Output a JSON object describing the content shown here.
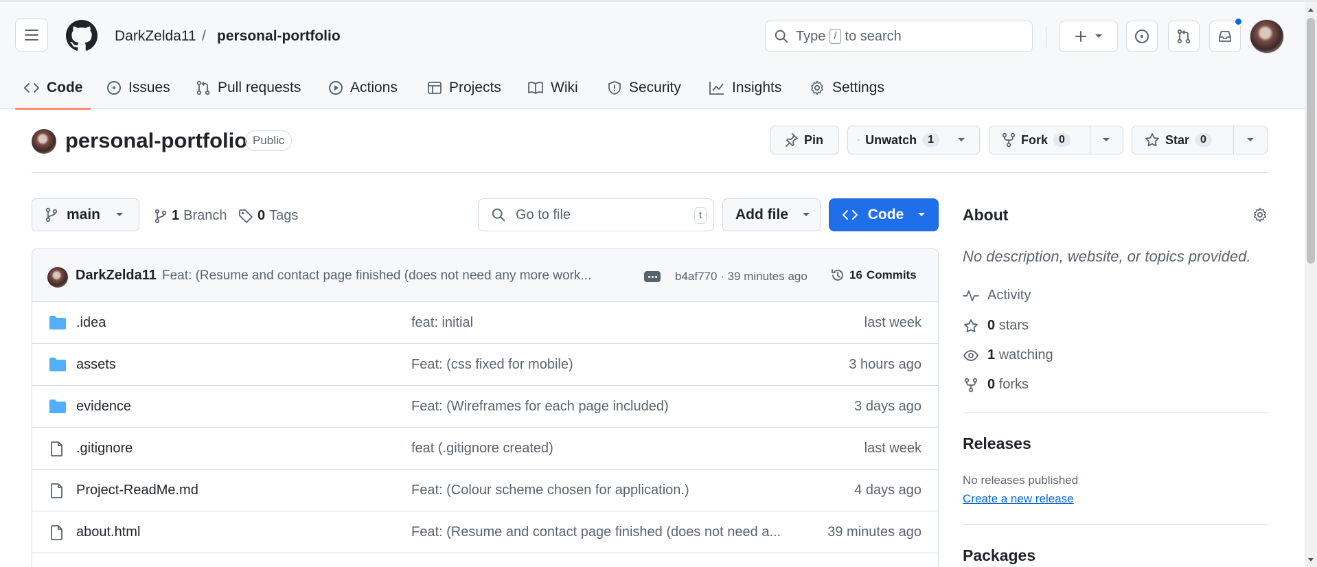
{
  "header": {
    "owner": "DarkZelda11",
    "separator": "/",
    "repo": "personal-portfolio",
    "search": {
      "text_before": "Type",
      "key": "/",
      "text_after": "to search"
    },
    "icons": [
      "hamburger-icon",
      "github-logo-icon",
      "search-icon",
      "plus-icon",
      "issue-opened-icon",
      "pull-request-icon",
      "inbox-icon"
    ]
  },
  "nav": {
    "tabs": [
      {
        "label": "Code",
        "icon": "code-icon"
      },
      {
        "label": "Issues",
        "icon": "issue-opened-icon"
      },
      {
        "label": "Pull requests",
        "icon": "pull-request-icon"
      },
      {
        "label": "Actions",
        "icon": "play-icon"
      },
      {
        "label": "Projects",
        "icon": "table-icon"
      },
      {
        "label": "Wiki",
        "icon": "book-icon"
      },
      {
        "label": "Security",
        "icon": "shield-icon"
      },
      {
        "label": "Insights",
        "icon": "graph-icon"
      },
      {
        "label": "Settings",
        "icon": "gear-icon"
      }
    ],
    "active": "Code"
  },
  "repo": {
    "title": "personal-portfolio",
    "visibility": "Public",
    "pin_label": "Pin",
    "watch_label": "Unwatch",
    "watch_count": "1",
    "fork_label": "Fork",
    "fork_count": "0",
    "star_label": "Star",
    "star_count": "0"
  },
  "toolbar": {
    "branch": "main",
    "branches_count": "1",
    "branches_label": "Branch",
    "tags_count": "0",
    "tags_label": "Tags",
    "goto_placeholder": "Go to file",
    "goto_key": "t",
    "add_file_label": "Add file",
    "code_label": "Code"
  },
  "latest_commit": {
    "author": "DarkZelda11",
    "message": "Feat: (Resume and contact page finished (does not need any more work...",
    "hash": "b4af770",
    "dot": "·",
    "time": "39 minutes ago",
    "commits_count": "16",
    "commits_label": "Commits"
  },
  "files": [
    {
      "type": "folder",
      "name": ".idea",
      "message": "feat: initial",
      "time": "last week"
    },
    {
      "type": "folder",
      "name": "assets",
      "message": "Feat: (css fixed for mobile)",
      "time": "3 hours ago"
    },
    {
      "type": "folder",
      "name": "evidence",
      "message": "Feat: (Wireframes for each page included)",
      "time": "3 days ago"
    },
    {
      "type": "file",
      "name": ".gitignore",
      "message": "feat (.gitignore created)",
      "time": "last week"
    },
    {
      "type": "file",
      "name": "Project-ReadMe.md",
      "message": "Feat: (Colour scheme chosen for application.)",
      "time": "4 days ago"
    },
    {
      "type": "file",
      "name": "about.html",
      "message": "Feat: (Resume and contact page finished (does not need a...",
      "time": "39 minutes ago"
    }
  ],
  "about": {
    "heading": "About",
    "description": "No description, website, or topics provided.",
    "activity_label": "Activity",
    "stars_count": "0",
    "stars_label": "stars",
    "watching_count": "1",
    "watching_label": "watching",
    "forks_count": "0",
    "forks_label": "forks"
  },
  "releases": {
    "heading": "Releases",
    "empty_text": "No releases published",
    "create_link": "Create a new release"
  },
  "packages": {
    "heading": "Packages"
  },
  "colors": {
    "primary_button": "#1f6feb",
    "folder": "#54aeff",
    "tab_underline": "#fd8c73",
    "notification": "#0969da"
  }
}
